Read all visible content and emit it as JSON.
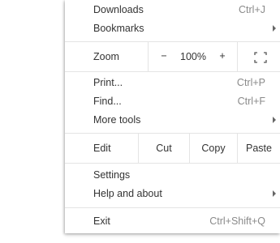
{
  "menu": {
    "downloads": {
      "label": "Downloads",
      "shortcut": "Ctrl+J"
    },
    "bookmarks": {
      "label": "Bookmarks"
    },
    "zoom": {
      "label": "Zoom",
      "minus": "−",
      "value": "100%",
      "plus": "+",
      "fullscreen_icon": "fullscreen-icon"
    },
    "print": {
      "label": "Print...",
      "shortcut": "Ctrl+P"
    },
    "find": {
      "label": "Find...",
      "shortcut": "Ctrl+F"
    },
    "more_tools": {
      "label": "More tools"
    },
    "edit": {
      "label": "Edit",
      "cut": "Cut",
      "copy": "Copy",
      "paste": "Paste"
    },
    "settings": {
      "label": "Settings"
    },
    "help": {
      "label": "Help and about"
    },
    "exit": {
      "label": "Exit",
      "shortcut": "Ctrl+Shift+Q"
    }
  }
}
